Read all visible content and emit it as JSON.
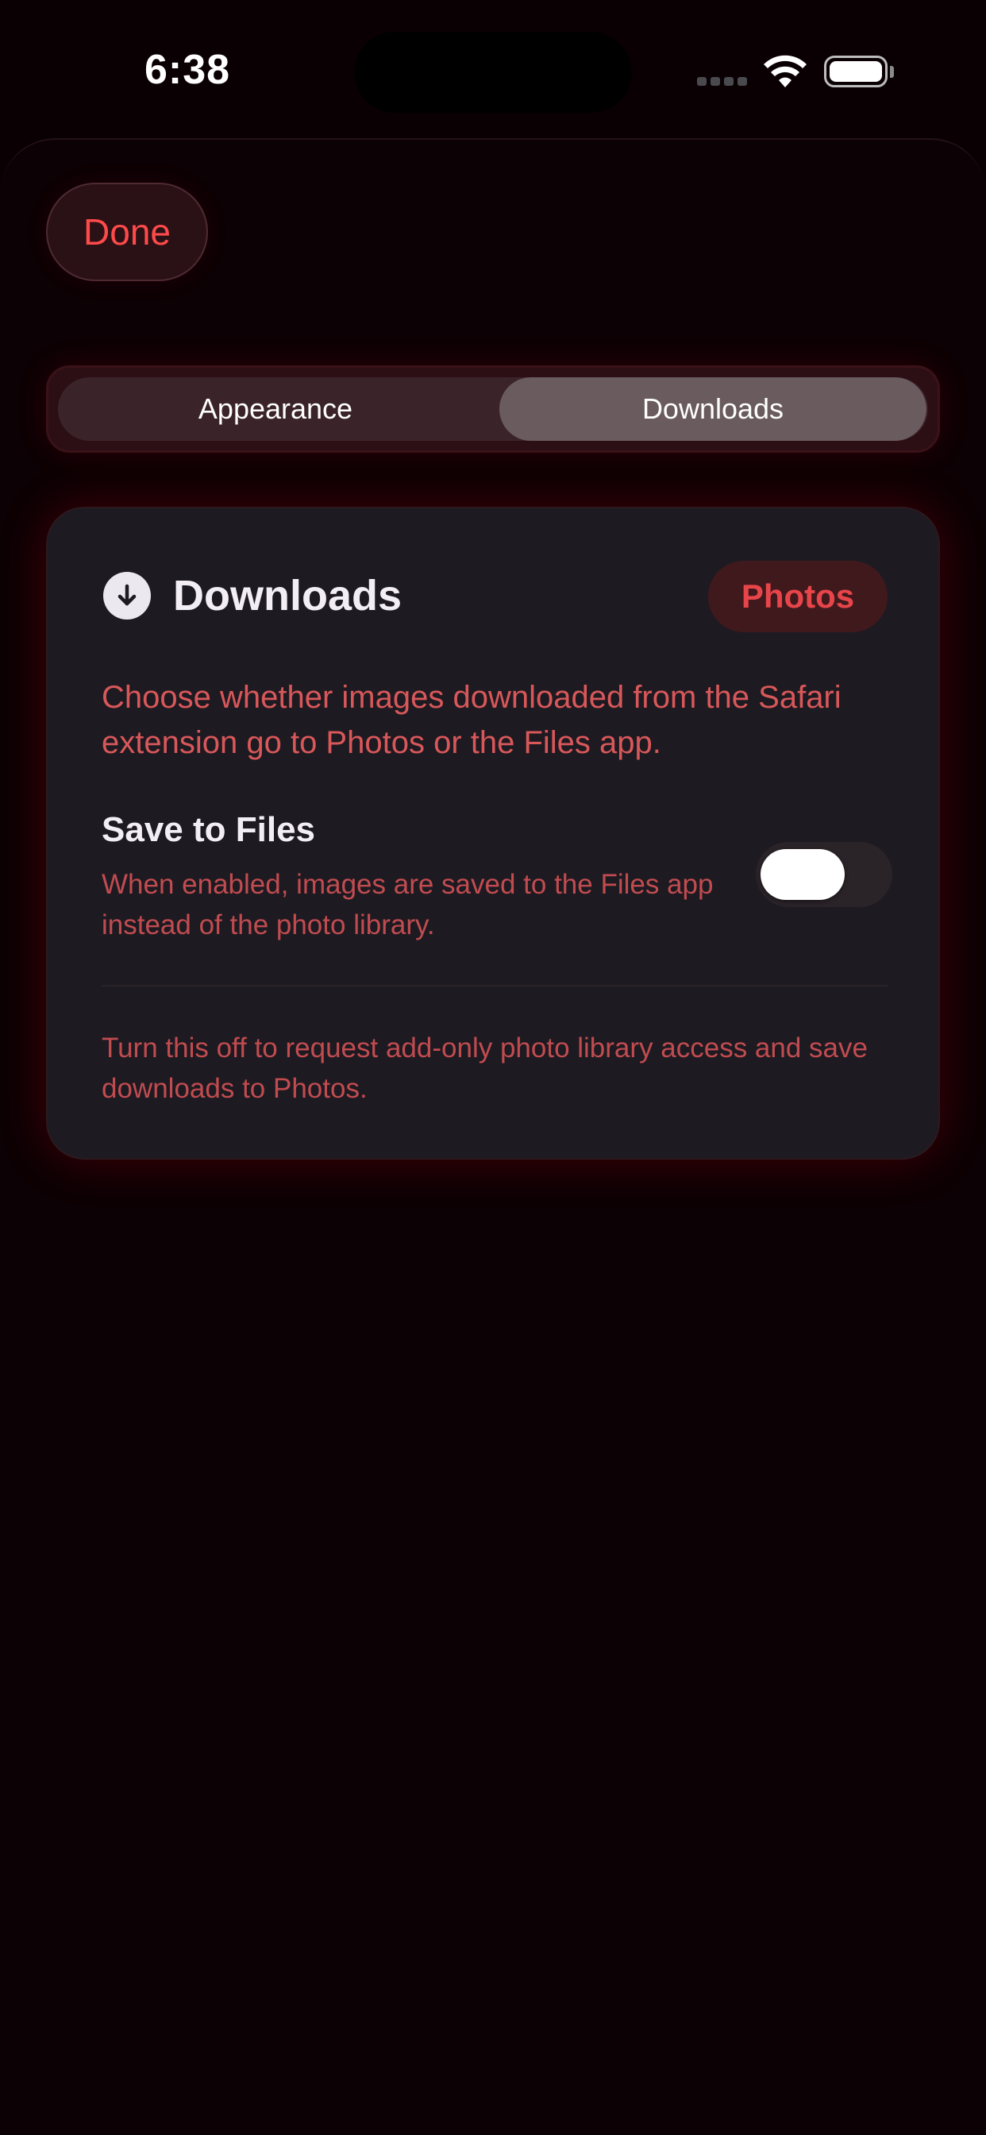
{
  "status_bar": {
    "time": "6:38",
    "icons": [
      "cellular-signal-icon",
      "wifi-icon",
      "battery-icon"
    ]
  },
  "header": {
    "done_label": "Done"
  },
  "tabs": [
    {
      "label": "Appearance",
      "selected": false
    },
    {
      "label": "Downloads",
      "selected": true
    }
  ],
  "downloads_card": {
    "icon": "download-arrow-icon",
    "title": "Downloads",
    "badge": "Photos",
    "description": "Choose whether images downloaded from the Safari extension go to Photos or the Files app.",
    "save_to_files": {
      "title": "Save to Files",
      "description": "When enabled, images are saved to the Files app instead of the photo library.",
      "enabled": false
    },
    "footer": "Turn this off to request add-only photo library access and save downloads to Photos."
  },
  "colors": {
    "accent": "#ff4a4a",
    "background": "#0a0003",
    "card": "#1e1a21"
  }
}
